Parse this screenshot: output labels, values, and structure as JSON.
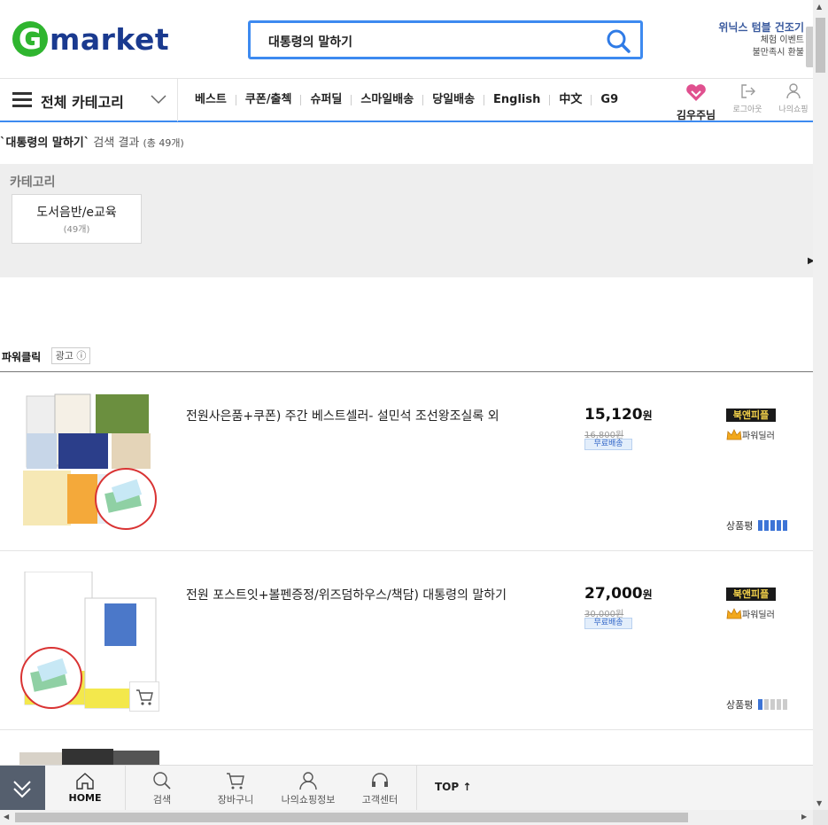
{
  "header": {
    "logo_letter": "G",
    "logo_text": "market",
    "search_value": "대통령의 말하기",
    "promo_title": "위닉스 텀블 건조기",
    "promo_line1": "체험 이벤트",
    "promo_line2": "불만족시 환불"
  },
  "nav": {
    "all_categories": "전체 카테고리",
    "menu": [
      "베스트",
      "쿠폰/출첵",
      "슈퍼딜",
      "스마일배송",
      "당일배송",
      "English",
      "中文",
      "G9"
    ],
    "user_name": "김우주님",
    "logout": "로그아웃",
    "my_shopping": "나의쇼핑"
  },
  "results": {
    "query": "`대통령의 말하기`",
    "label": "검색 결과",
    "count": "(총 49개)"
  },
  "category": {
    "title": "카테고리",
    "items": [
      {
        "name": "도서음반/e교육",
        "count": "(49개)"
      }
    ]
  },
  "powerclick": {
    "title": "파워클릭",
    "ad_label": "광고"
  },
  "products": [
    {
      "title": "전원사은품+쿠폰) 주간 베스트셀러- 설민석 조선왕조실록 외",
      "price": "15,120",
      "price_unit": "원",
      "original_price": "16,800원",
      "shipping": "무료배송",
      "seller": "북앤피플",
      "dealer": "파워딜러",
      "review_label": "상품평",
      "rating": 5
    },
    {
      "title": "전원 포스트잇+볼펜증정/위즈덤하우스/책담) 대통령의 말하기",
      "price": "27,000",
      "price_unit": "원",
      "original_price": "30,000원",
      "shipping": "무료배송",
      "seller": "북앤피플",
      "dealer": "파워딜러",
      "review_label": "상품평",
      "rating": 1
    }
  ],
  "bottombar": {
    "home": "HOME",
    "search": "검색",
    "cart": "장바구니",
    "myinfo": "나의쇼핑정보",
    "support": "고객센터",
    "top": "TOP ↑"
  },
  "colors": {
    "brand_green": "#2fb52f",
    "brand_blue": "#1a3a8f",
    "accent": "#3d8af0",
    "rating_on": "#3d74d6"
  }
}
